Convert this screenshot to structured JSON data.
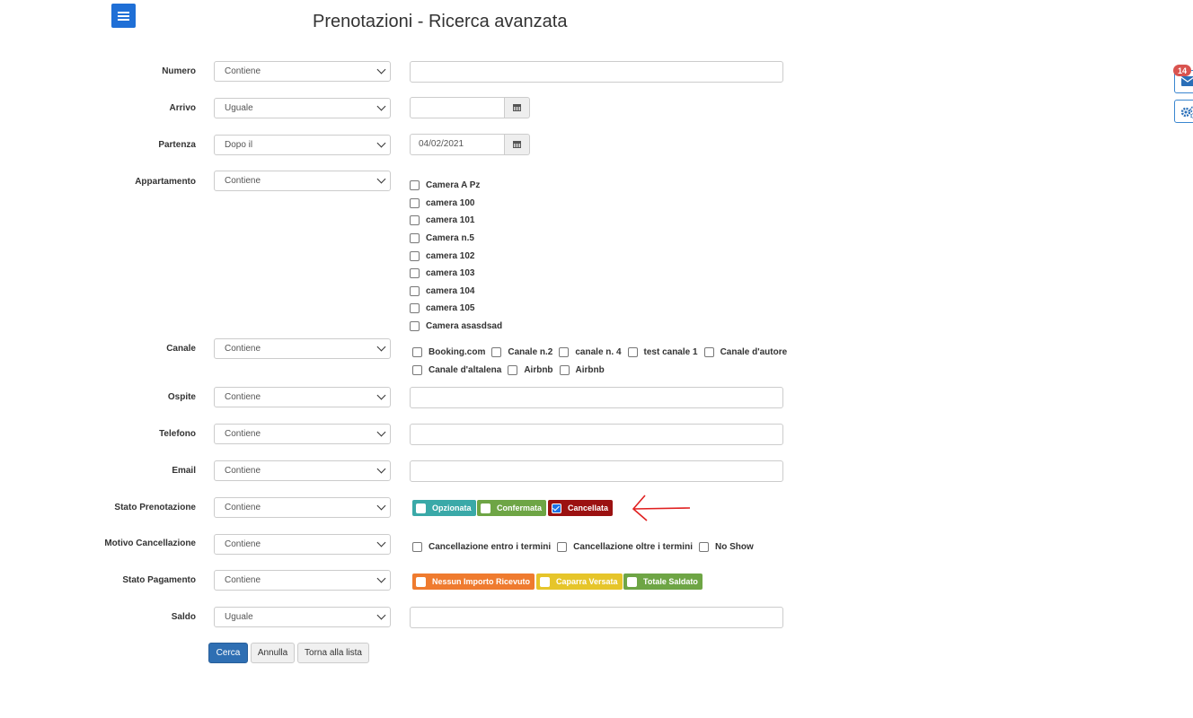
{
  "page": {
    "title": "Prenotazioni - Ricerca avanzata"
  },
  "colors": {
    "menu": "#1f6fd6",
    "opzionata": "#3aa9a8",
    "confermata": "#6ea545",
    "cancellata": "#9b1111",
    "nessun_importo": "#ef7b2f",
    "caparra": "#e6c52a",
    "totale_saldato": "#6ea545",
    "primary_button": "#2f6fb3",
    "annotation_arrow": "#e02020"
  },
  "fields": {
    "numero": {
      "label": "Numero",
      "operator": "Contiene"
    },
    "arrivo": {
      "label": "Arrivo",
      "operator": "Uguale",
      "date": ""
    },
    "partenza": {
      "label": "Partenza",
      "operator": "Dopo il",
      "date": "04/02/2021"
    },
    "appartamento": {
      "label": "Appartamento",
      "operator": "Contiene",
      "options": [
        "Camera A Pz",
        "camera 100",
        "camera 101",
        "Camera n.5",
        "camera 102",
        "camera 103",
        "camera 104",
        "camera 105",
        "Camera asasdsad"
      ]
    },
    "canale": {
      "label": "Canale",
      "operator": "Contiene",
      "row1": [
        "Booking.com",
        "Canale n.2",
        "canale n. 4",
        "test canale 1",
        "Canale d'autore"
      ],
      "row2": [
        "Canale d'altalena",
        "Airbnb",
        "Airbnb"
      ]
    },
    "ospite": {
      "label": "Ospite",
      "operator": "Contiene"
    },
    "telefono": {
      "label": "Telefono",
      "operator": "Contiene"
    },
    "email": {
      "label": "Email",
      "operator": "Contiene"
    },
    "stato_prenotazione": {
      "label": "Stato Prenotazione",
      "operator": "Contiene",
      "badges": [
        {
          "label": "Opzionata",
          "checked": false
        },
        {
          "label": "Confermata",
          "checked": false
        },
        {
          "label": "Cancellata",
          "checked": true
        }
      ]
    },
    "motivo_cancellazione": {
      "label": "Motivo Cancellazione",
      "operator": "Contiene",
      "options": [
        "Cancellazione entro i termini",
        "Cancellazione oltre i termini",
        "No Show"
      ]
    },
    "stato_pagamento": {
      "label": "Stato Pagamento",
      "operator": "Contiene",
      "badges": [
        {
          "label": "Nessun Importo Ricevuto",
          "checked": false
        },
        {
          "label": "Caparra Versata",
          "checked": false
        },
        {
          "label": "Totale Saldato",
          "checked": false
        }
      ]
    },
    "saldo": {
      "label": "Saldo",
      "operator": "Uguale"
    }
  },
  "buttons": {
    "cerca": "Cerca",
    "annulla": "Annulla",
    "torna": "Torna alla lista"
  },
  "side": {
    "mail_count": "14"
  }
}
